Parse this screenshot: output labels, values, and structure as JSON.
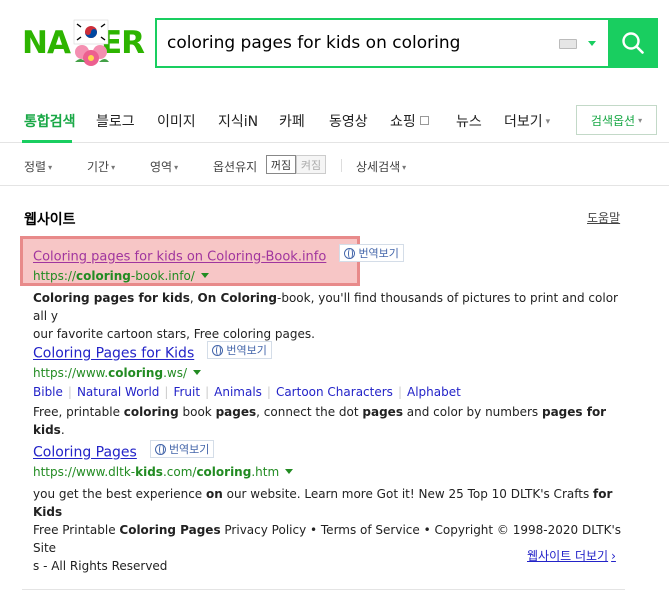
{
  "logo": {
    "text": "NAVER",
    "left": "NA",
    "right": "ER"
  },
  "search": {
    "query": "coloring pages for kids on coloring",
    "keyboard_icon": "keyboard-icon",
    "button_icon": "magnifier-icon"
  },
  "tabs": [
    {
      "label": "통합검색",
      "active": true
    },
    {
      "label": "블로그"
    },
    {
      "label": "이미지"
    },
    {
      "label": "지식iN"
    },
    {
      "label": "카페"
    },
    {
      "label": "동영상"
    },
    {
      "label": "쇼핑"
    },
    {
      "label": "뉴스"
    },
    {
      "label": "더보기"
    }
  ],
  "search_options_label": "검색옵션",
  "filters": {
    "sort": "정렬",
    "period": "기간",
    "area": "영역",
    "keep_option": "옵션유지",
    "off": "꺼짐",
    "on": "켜짐",
    "detail": "상세검색"
  },
  "section": {
    "title": "웹사이트",
    "help": "도움말",
    "more": "웹사이트 더보기"
  },
  "translate_label": "번역보기",
  "results": [
    {
      "title_bold": "Coloring pages for kids on Coloring",
      "title_rest": "-Book.info",
      "url_prefix": "https://",
      "url_bold": "coloring",
      "url_suffix": "-book.info/",
      "desc_1": "Coloring pages for kids",
      "desc_2": ", ",
      "desc_3": "On Coloring",
      "desc_4": "-book, you'll find thousands of pictures to print and color all y",
      "desc_5": "our favorite cartoon stars, Free coloring pages."
    },
    {
      "title": "Coloring Pages for Kids",
      "url_prefix": "https://www.",
      "url_bold": "coloring",
      "url_suffix": ".ws/",
      "sublinks": [
        "Bible",
        "Natural World",
        "Fruit",
        "Animals",
        "Cartoon Characters",
        "Alphabet"
      ],
      "desc_1": "Free, printable ",
      "desc_2": "coloring",
      "desc_3": " book ",
      "desc_4": "pages",
      "desc_5": ", connect the dot ",
      "desc_6": "pages",
      "desc_7": " and color by numbers ",
      "desc_8": "pages for kids",
      "desc_9": "."
    },
    {
      "title": "Coloring Pages",
      "url_prefix": "https://www.dltk-",
      "url_bold": "kids",
      "url_mid": ".com/",
      "url_bold2": "coloring",
      "url_suffix": ".htm",
      "desc_1": "you get the best experience ",
      "desc_2": "on",
      "desc_3": " our website. Learn more Got it! New 25 Top 10 DLTK's Crafts ",
      "desc_4": "for Kids",
      "desc_5": " Free Printable ",
      "desc_6": "Coloring Pages",
      "desc_7": " Privacy Policy • Terms of Service • Copyright © 1998-2020 DLTK's Site",
      "desc_8": "s - All Rights Reserved"
    }
  ],
  "colors": {
    "brand_green": "#19ce60",
    "link_blue": "#2323c8",
    "visited_purple": "#a0359e",
    "url_green": "#228b22",
    "highlight_fill": "#f7c6c6",
    "highlight_border": "#e88a8a"
  }
}
